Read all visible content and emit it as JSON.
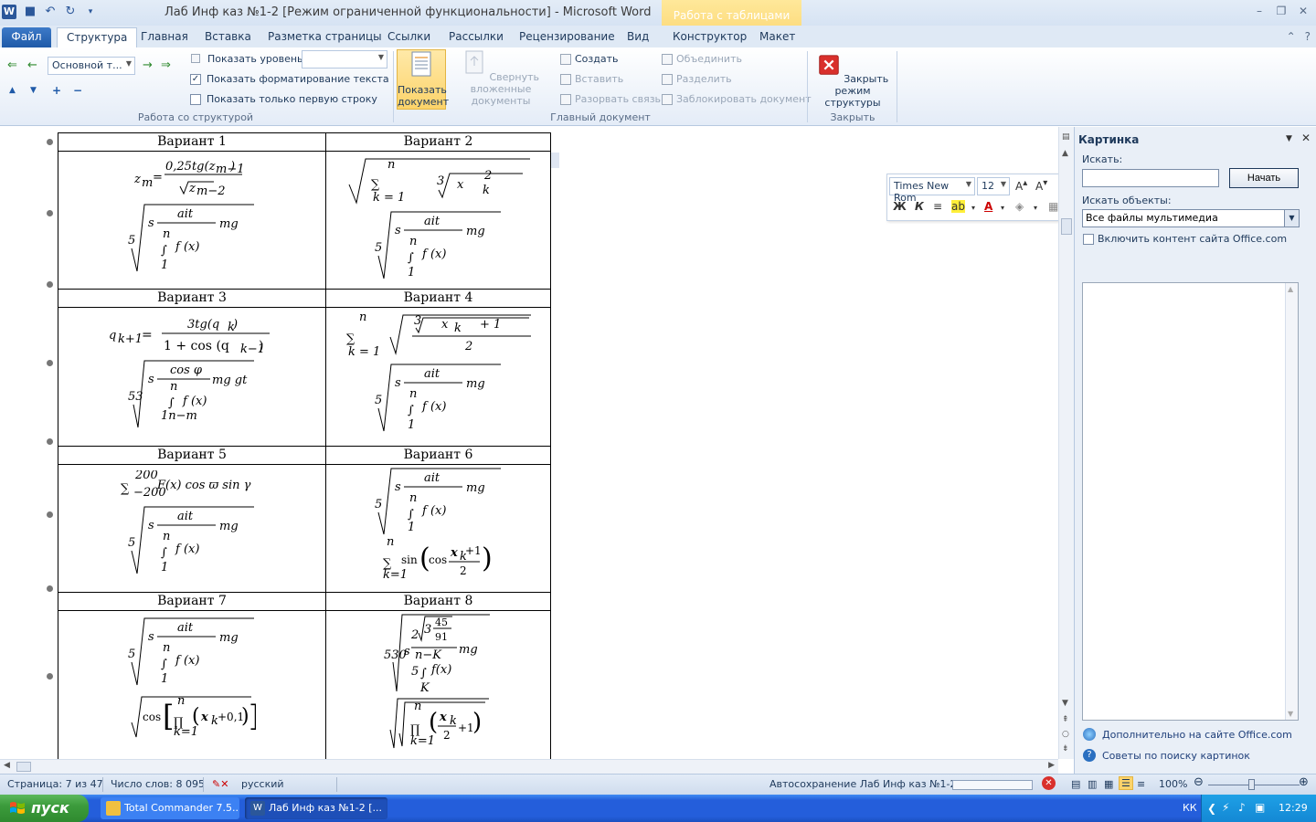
{
  "titlebar": {
    "logo": "W",
    "title": "Лаб Инф каз №1-2 [Режим ограниченной функциональности]  -  Microsoft Word",
    "context_tab_group": "Работа с таблицами",
    "qat_icons": [
      "save-icon",
      "undo-icon",
      "redo-icon",
      "customize-icon"
    ],
    "window_controls": [
      "minimize-icon",
      "restore-icon",
      "close-icon"
    ]
  },
  "tabs": {
    "file": "Файл",
    "items": [
      "Структура",
      "Главная",
      "Вставка",
      "Разметка страницы",
      "Ссылки",
      "Рассылки",
      "Рецензирование",
      "Вид",
      "Конструктор",
      "Макет"
    ],
    "active": "Структура"
  },
  "ribbon": {
    "outline": {
      "level_value": "Основной т...",
      "show_level_label": "Показать уровень:",
      "show_level_value": "",
      "show_formatting_label": "Показать форматирование текста",
      "show_formatting_checked": true,
      "first_line_only_label": "Показать только первую строку",
      "first_line_only_checked": false,
      "group_label": "Работа со структурой"
    },
    "master": {
      "show_document": "Показать документ",
      "collapse_subdocs": "Свернуть вложенные документы",
      "create": "Создать",
      "insert": "Вставить",
      "unlink": "Разорвать связь",
      "merge": "Объединить",
      "split": "Разделить",
      "lock": "Заблокировать документ",
      "group_label": "Главный документ"
    },
    "close": {
      "close_outline": "Закрыть режим структуры",
      "group_label": "Закрыть"
    }
  },
  "document": {
    "variants": [
      {
        "left": "Вариант  1",
        "right": "Вариант  2"
      },
      {
        "left": "Вариант  3",
        "right": "Вариант  4"
      },
      {
        "left": "Вариант  5",
        "right": "Вариант  6"
      },
      {
        "left": "Вариант  7",
        "right": "Вариант  8"
      }
    ]
  },
  "minitoolbar": {
    "font": "Times New Rom",
    "size": "12",
    "bold": "Ж",
    "italic": "К"
  },
  "taskpane": {
    "title": "Картинка",
    "search_label": "Искать:",
    "search_value": "",
    "go_button": "Начать",
    "objects_label": "Искать объекты:",
    "objects_value": "Все файлы мультимедиа",
    "office_content_label": "Включить контент сайта Office.com",
    "office_content_checked": false,
    "link_more": "Дополнительно на сайте Office.com",
    "link_tips": "Советы по поиску картинок"
  },
  "statusbar": {
    "page": "Страница: 7 из 47",
    "words": "Число слов: 8 095",
    "language": "русский",
    "autosave": "Автосохранение Лаб Инф каз №1-2:",
    "zoom": "100%"
  },
  "taskbar": {
    "start": "пуск",
    "items": [
      "Total Commander 7.5...",
      "Лаб Инф каз №1-2 [..."
    ],
    "lang": "КК",
    "clock": "12:29"
  },
  "colors": {
    "ribbon_bg": "#e4ecf7",
    "accent": "#2b579a",
    "context_tab": "#fbd46d",
    "taskbar": "#245edb",
    "start_button": "#3c9b3c"
  }
}
